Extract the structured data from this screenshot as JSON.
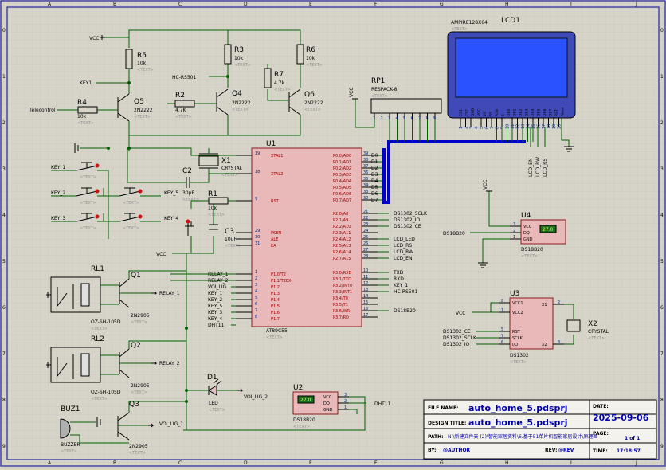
{
  "sheet": {
    "col_labels": [
      "A",
      "B",
      "C",
      "D",
      "E",
      "F",
      "G",
      "H",
      "I",
      "J"
    ],
    "row_labels": [
      "0",
      "1",
      "2",
      "3",
      "4",
      "5",
      "6",
      "7",
      "8",
      "9"
    ],
    "colors": {
      "background": "#d6d3c9",
      "grid": "#c4c1b5",
      "border": "#24249c",
      "body": "#e9b8b8",
      "wire": "#006000",
      "bus": "#0000c8"
    }
  },
  "placeholder": "<TEXT>",
  "top": {
    "vcc1": "VCC",
    "key1": "KEY1",
    "telecontrol": "Telecontrol",
    "hc_rs501": "HC-RS501",
    "r5": {
      "ref": "R5",
      "val": "10k"
    },
    "r3": {
      "ref": "R3",
      "val": "10k"
    },
    "r6": {
      "ref": "R6",
      "val": "10k"
    },
    "r7": {
      "ref": "R7",
      "val": "4.7k"
    },
    "r4": {
      "ref": "R4",
      "val": "10k"
    },
    "r2": {
      "ref": "R2",
      "val": "4.7K"
    },
    "q5": {
      "ref": "Q5",
      "val": "2N2222"
    },
    "q4": {
      "ref": "Q4",
      "val": "2N2222"
    },
    "q6": {
      "ref": "Q6",
      "val": "2N2222"
    }
  },
  "left": {
    "key_labels": [
      "KEY_1",
      "KEY_2",
      "KEY_3",
      "KEY_5",
      "KEY_4"
    ],
    "x1": {
      "ref": "X1",
      "val": "CRYSTAL"
    },
    "c2": {
      "ref": "C2",
      "val": "30pF"
    },
    "r1": {
      "ref": "R1",
      "val": "10k"
    },
    "c3": {
      "ref": "C3",
      "val": "10uF"
    },
    "vcc2": "VCC"
  },
  "mcu": {
    "ref": "U1",
    "part": "AT89C55",
    "left_pins": [
      {
        "num": "19",
        "name": "XTAL1"
      },
      {
        "num": "18",
        "name": "XTAL2"
      },
      {
        "num": "9",
        "name": "RST"
      },
      {
        "num": "29",
        "name": "PSEN"
      },
      {
        "num": "30",
        "name": "ALE"
      },
      {
        "num": "31",
        "name": "EA"
      },
      {
        "num": "1",
        "name": "P1.0/T2"
      },
      {
        "num": "2",
        "name": "P1.1/T2EX"
      },
      {
        "num": "3",
        "name": "P1.2"
      },
      {
        "num": "4",
        "name": "P1.3"
      },
      {
        "num": "5",
        "name": "P1.4"
      },
      {
        "num": "6",
        "name": "P1.5"
      },
      {
        "num": "7",
        "name": "P1.6"
      },
      {
        "num": "8",
        "name": "P1.7"
      }
    ],
    "left_nets": [
      "RELAY_1",
      "RELAY_2",
      "VOI_LIG",
      "KEY_1",
      "KEY_2",
      "KEY_5",
      "KEY_3",
      "KEY_4",
      "DHT11"
    ],
    "right_pins": [
      {
        "num": "39",
        "name": "P0.0/AD0",
        "net": "D0"
      },
      {
        "num": "38",
        "name": "P0.1/AD1",
        "net": "D1"
      },
      {
        "num": "37",
        "name": "P0.2/AD2",
        "net": "D2"
      },
      {
        "num": "36",
        "name": "P0.3/AD3",
        "net": "D3"
      },
      {
        "num": "35",
        "name": "P0.4/AD4",
        "net": "D4"
      },
      {
        "num": "34",
        "name": "P0.5/AD5",
        "net": "D5"
      },
      {
        "num": "33",
        "name": "P0.6/AD6",
        "net": "D6"
      },
      {
        "num": "32",
        "name": "P0.7/AD7",
        "net": "D7"
      },
      {
        "num": "21",
        "name": "P2.0/A8",
        "net": "DS1302_SCLK"
      },
      {
        "num": "22",
        "name": "P2.1/A9",
        "net": "DS1302_IO"
      },
      {
        "num": "23",
        "name": "P2.2/A10",
        "net": "DS1302_CE"
      },
      {
        "num": "24",
        "name": "P2.3/A11",
        "net": ""
      },
      {
        "num": "25",
        "name": "P2.4/A12",
        "net": "LCD_LED"
      },
      {
        "num": "26",
        "name": "P2.5/A13",
        "net": "LCD_RS"
      },
      {
        "num": "27",
        "name": "P2.6/A14",
        "net": "LCD_RW"
      },
      {
        "num": "28",
        "name": "P2.7/A15",
        "net": "LCD_EN"
      },
      {
        "num": "10",
        "name": "P3.0/RXD",
        "net": "TXD"
      },
      {
        "num": "11",
        "name": "P3.1/TXD",
        "net": "RXD"
      },
      {
        "num": "12",
        "name": "P3.2/INT0",
        "net": "KEY_1"
      },
      {
        "num": "13",
        "name": "P3.3/INT1",
        "net": "HC-RS501"
      },
      {
        "num": "14",
        "name": "P3.4/T0",
        "net": ""
      },
      {
        "num": "15",
        "name": "P3.5/T1",
        "net": ""
      },
      {
        "num": "16",
        "name": "P3.6/WR",
        "net": "DS18B20"
      },
      {
        "num": "17",
        "name": "P3.7/RD",
        "net": ""
      }
    ]
  },
  "lcd": {
    "ref": "LCD1",
    "part": "AMPIRE128X64",
    "pins": [
      "CS1",
      "CS2",
      "GND",
      "VCC",
      "V0",
      "RS",
      "R/W",
      "E",
      "DB0",
      "DB1",
      "DB2",
      "DB3",
      "DB4",
      "DB5",
      "DB6",
      "DB7",
      "RST",
      "-Vout"
    ],
    "pin_nums": [
      "1",
      "2",
      "3",
      "4",
      "5",
      "6",
      "7",
      "8",
      "9",
      "10",
      "11",
      "12",
      "13",
      "14",
      "15",
      "16",
      "17",
      "18",
      "19",
      "20"
    ],
    "nets": [
      "LCD_EN",
      "LCD_RW",
      "LCD_RS"
    ],
    "screen_color": "#2a52ff"
  },
  "rp1": {
    "ref": "RP1",
    "part": "RESPACK-8",
    "vcc": "VCC",
    "pins": [
      "1",
      "2",
      "3",
      "4",
      "5",
      "6",
      "7",
      "8",
      "9"
    ]
  },
  "u4": {
    "ref": "U4",
    "part": "DS18B20",
    "vcc": "VCC",
    "pins": [
      "VCC",
      "DQ",
      "GND"
    ],
    "nums": [
      "3",
      "2",
      "1"
    ],
    "net": "DS18B20",
    "temp": "27.0"
  },
  "u3": {
    "ref": "U3",
    "part": "DS1302",
    "vcc": "VCC",
    "left": [
      "VCC1",
      "VCC2",
      "RST",
      "SCLK",
      "I/O"
    ],
    "left_nums": [
      "8",
      "1",
      "5",
      "7",
      "6"
    ],
    "right": [
      "X1",
      "X2"
    ],
    "right_nums": [
      "2",
      "3"
    ],
    "nets": [
      "DS1302_CE",
      "DS1302_SCLK",
      "DS1302_IO"
    ],
    "x2": {
      "ref": "X2",
      "val": "CRYSTAL"
    }
  },
  "relays": [
    {
      "ref": "RL1",
      "part": "OZ-SH-105D",
      "q": "Q1",
      "qpart": "2N2905",
      "net": "RELAY_1"
    },
    {
      "ref": "RL2",
      "part": "OZ-SH-105D",
      "q": "Q2",
      "qpart": "2N2905",
      "net": "RELAY_2"
    }
  ],
  "d1": {
    "ref": "D1",
    "part": "LED",
    "net": "VOI_LIG_2"
  },
  "u2": {
    "ref": "U2",
    "part": "DS18B20",
    "pins": [
      "VCC",
      "DQ",
      "GND"
    ],
    "nums": [
      "3",
      "2",
      "1"
    ],
    "net": "DHT11",
    "temp": "27.0"
  },
  "buz": {
    "ref": "BUZ1",
    "part": "BUZZER",
    "q": "Q3",
    "qpart": "2N2905",
    "net": "VOI_LIG_1"
  },
  "title_block": {
    "file_name_label": "FILE NAME:",
    "file_name": "auto_home_5.pdsprj",
    "design_title_label": "DESIGN TITLE:",
    "design_title": "auto_home_5.pdsprj",
    "path_label": "PATH:",
    "path": "N:\\新建文件夹 (2)\\智能家居资料\\6.基于51单片机智能家居设计\\原理图",
    "by_label": "BY:",
    "by": "@AUTHOR",
    "rev_label": "REV:",
    "rev": "@REV",
    "date_label": "DATE:",
    "date": "2025-09-06",
    "page_label": "PAGE:",
    "page": "1 of 1",
    "time_label": "TIME:",
    "time": "17:18:57"
  }
}
